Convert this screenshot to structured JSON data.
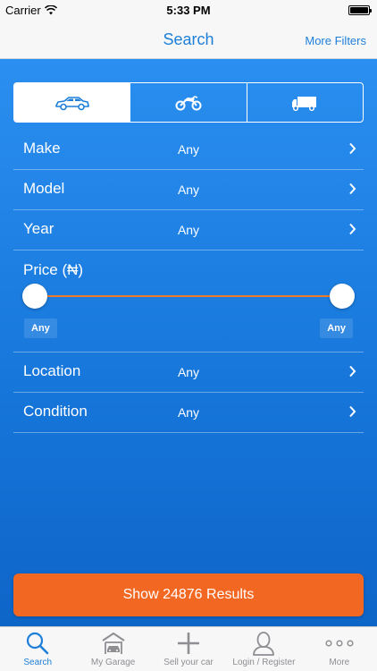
{
  "status_bar": {
    "carrier": "Carrier",
    "time": "5:33 PM"
  },
  "nav": {
    "title": "Search",
    "more_filters": "More Filters"
  },
  "vehicle_types": [
    {
      "icon": "car-icon",
      "selected": true
    },
    {
      "icon": "motorcycle-icon",
      "selected": false
    },
    {
      "icon": "truck-icon",
      "selected": false
    }
  ],
  "filters": {
    "make": {
      "label": "Make",
      "value": "Any"
    },
    "model": {
      "label": "Model",
      "value": "Any"
    },
    "year": {
      "label": "Year",
      "value": "Any"
    },
    "price": {
      "label": "Price (₦)",
      "min": "Any",
      "max": "Any",
      "range_min_fraction": 0,
      "range_max_fraction": 1
    },
    "location": {
      "label": "Location",
      "value": "Any"
    },
    "condition": {
      "label": "Condition",
      "value": "Any"
    }
  },
  "show_results": {
    "label": "Show 24876 Results"
  },
  "tabs": [
    {
      "label": "Search",
      "icon": "search-icon",
      "active": true
    },
    {
      "label": "My Garage",
      "icon": "garage-icon",
      "active": false
    },
    {
      "label": "Sell your car",
      "icon": "plus-icon",
      "active": false
    },
    {
      "label": "Login / Register",
      "icon": "user-icon",
      "active": false
    },
    {
      "label": "More",
      "icon": "more-icon",
      "active": false
    }
  ],
  "colors": {
    "accent": "#1e7fd9",
    "primary_bg": "#1675d9",
    "cta": "#f26722",
    "slider_track": "#f07a2a"
  }
}
